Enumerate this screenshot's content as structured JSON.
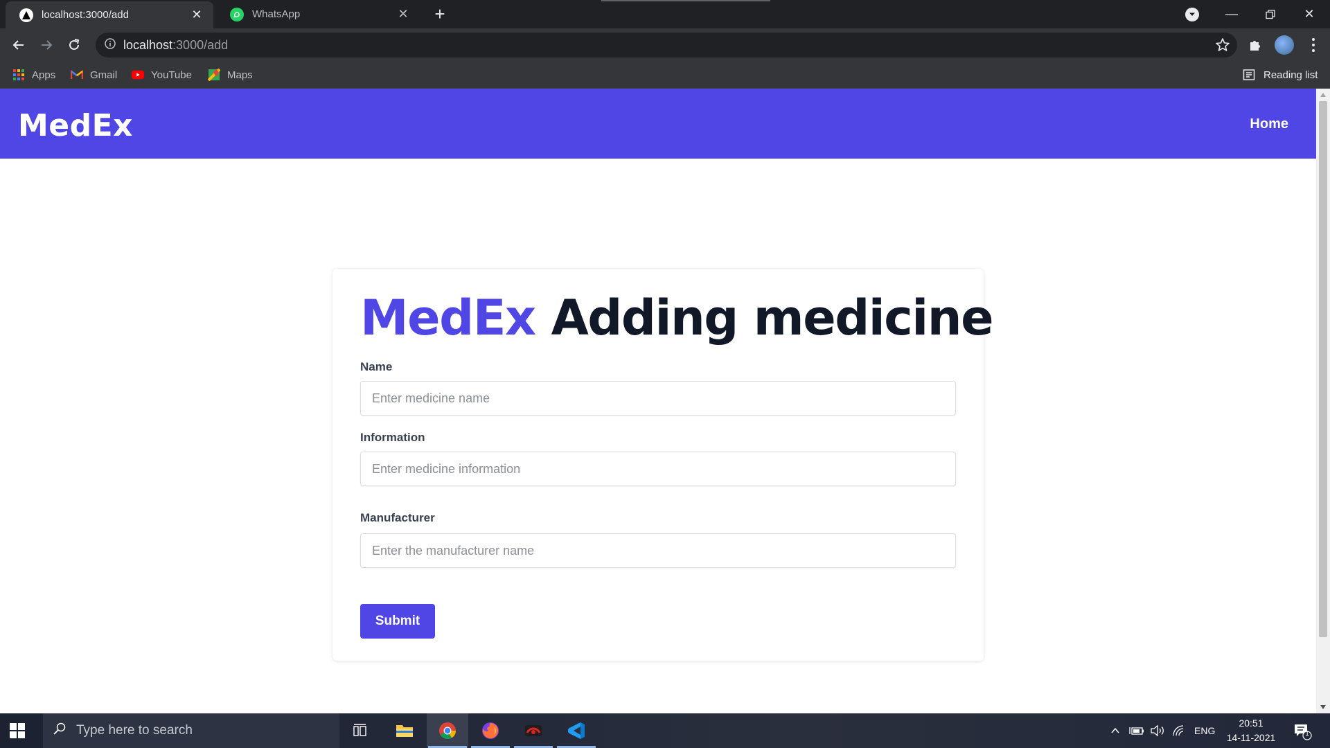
{
  "browser": {
    "tabs": [
      {
        "title": "localhost:3000/add",
        "active": true
      },
      {
        "title": "WhatsApp",
        "active": false
      }
    ],
    "address": {
      "host": "localhost",
      "path": ":3000/add"
    },
    "bookmarks": [
      {
        "label": "Apps",
        "icon": "apps-grid-icon"
      },
      {
        "label": "Gmail",
        "icon": "gmail-icon"
      },
      {
        "label": "YouTube",
        "icon": "youtube-icon"
      },
      {
        "label": "Maps",
        "icon": "maps-icon"
      }
    ],
    "reading_list": "Reading list"
  },
  "app": {
    "brand": "MedEx",
    "nav": {
      "home": "Home"
    },
    "form": {
      "heading_accent": "MedEx",
      "heading_rest": "Adding medicine",
      "fields": [
        {
          "label": "Name",
          "placeholder": "Enter medicine name"
        },
        {
          "label": "Information",
          "placeholder": "Enter medicine information"
        },
        {
          "label": "Manufacturer",
          "placeholder": "Enter the manufacturer name"
        }
      ],
      "submit": "Submit"
    }
  },
  "taskbar": {
    "search_placeholder": "Type here to search",
    "language": "ENG",
    "time": "20:51",
    "date": "14-11-2021",
    "notification_count": "1"
  },
  "colors": {
    "accent": "#4f46e5",
    "heading": "#111827"
  }
}
